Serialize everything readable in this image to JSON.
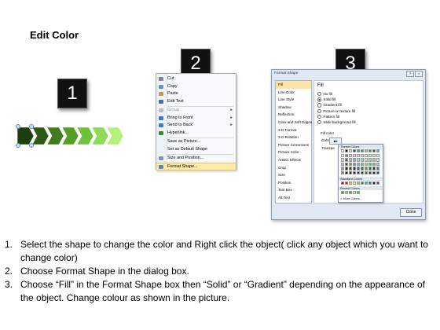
{
  "title": "Edit Color",
  "step_numbers": [
    "1",
    "2",
    "3"
  ],
  "context_menu": {
    "items": [
      {
        "label": "Cut",
        "icon": "scissors-icon",
        "icon_color": "#7a8aa0",
        "disabled": false,
        "submenu": false
      },
      {
        "label": "Copy",
        "icon": "copy-icon",
        "icon_color": "#6f8fc0",
        "disabled": false,
        "submenu": false
      },
      {
        "label": "Paste",
        "icon": "paste-icon",
        "icon_color": "#c59a45",
        "disabled": false,
        "submenu": false
      },
      {
        "label": "Edit Text",
        "icon": "edit-text-icon",
        "icon_color": "#4a6ea8",
        "disabled": false,
        "submenu": false
      },
      {
        "label": "Group",
        "icon": "group-icon",
        "icon_color": "#b8bec7",
        "disabled": true,
        "submenu": true
      },
      {
        "label": "Bring to Front",
        "icon": "bring-to-front-icon",
        "icon_color": "#3c78c8",
        "disabled": false,
        "submenu": true
      },
      {
        "label": "Send to Back",
        "icon": "send-to-back-icon",
        "icon_color": "#3c78c8",
        "disabled": false,
        "submenu": true
      },
      {
        "label": "Hyperlink...",
        "icon": "hyperlink-icon",
        "icon_color": "#3a8a3a",
        "disabled": false,
        "submenu": false
      },
      {
        "label": "Save as Picture...",
        "icon": "",
        "icon_color": "",
        "disabled": false,
        "submenu": false
      },
      {
        "label": "Set as Default Shape",
        "icon": "",
        "icon_color": "",
        "disabled": false,
        "submenu": false
      },
      {
        "label": "Size and Position...",
        "icon": "size-position-icon",
        "icon_color": "#7f95b5",
        "disabled": false,
        "submenu": false
      },
      {
        "label": "Format Shape...",
        "icon": "format-shape-icon",
        "icon_color": "#5d84c4",
        "disabled": false,
        "submenu": false,
        "highlighted": true
      }
    ]
  },
  "dialog": {
    "title": "Format Shape",
    "window_buttons": [
      "?",
      "×"
    ],
    "categories": [
      "Fill",
      "Line Color",
      "Line Style",
      "Shadow",
      "Reflection",
      "Glow and Soft Edges",
      "3-D Format",
      "3-D Rotation",
      "Picture Corrections",
      "Picture Color",
      "Artistic Effects",
      "Crop",
      "Size",
      "Position",
      "Text Box",
      "Alt Text"
    ],
    "selected_category": "Fill",
    "fill_heading": "Fill",
    "fill_options": [
      {
        "label": "No fill",
        "selected": false
      },
      {
        "label": "Solid fill",
        "selected": true
      },
      {
        "label": "Gradient fill",
        "selected": false
      },
      {
        "label": "Picture or texture fill",
        "selected": false
      },
      {
        "label": "Pattern fill",
        "selected": false
      },
      {
        "label": "Slide background fill",
        "selected": false
      }
    ],
    "fill_color_label": "Fill color",
    "color_label": "Color:",
    "transparency_label": "Transpa",
    "color_popup": {
      "theme_label": "Theme Colors",
      "standard_label": "Standard Colors",
      "recent_label": "Recent Colors",
      "more_label": "More Colors...",
      "theme_top_row": [
        "#ffffff",
        "#000000",
        "#eeece1",
        "#1f497d",
        "#4f81bd",
        "#00b050",
        "#92d050",
        "#00b050",
        "#375623",
        "#4bacc6"
      ],
      "theme_shades": [
        [
          "#f2f2f2",
          "#7f7f7f",
          "#ddd9c3",
          "#c6d9f0",
          "#dbe5f1",
          "#c6efce",
          "#ebf1de",
          "#c6efce",
          "#d8e4bc",
          "#dbeef3"
        ],
        [
          "#d8d8d8",
          "#595959",
          "#c4bd97",
          "#8db3e2",
          "#b8cce4",
          "#8ee0a0",
          "#d7e4bc",
          "#8ee0a0",
          "#b1c996",
          "#b7dde8"
        ],
        [
          "#bfbfbf",
          "#3f3f3f",
          "#938953",
          "#548dd4",
          "#95b3d7",
          "#55d070",
          "#c3d69b",
          "#55d070",
          "#8aad6e",
          "#92cddc"
        ],
        [
          "#a5a5a5",
          "#262626",
          "#494429",
          "#17365d",
          "#366092",
          "#008a3a",
          "#76923c",
          "#008a3a",
          "#294119",
          "#31859b"
        ],
        [
          "#7f7f7f",
          "#0c0c0c",
          "#1d1b10",
          "#0f243e",
          "#244061",
          "#005c26",
          "#4f6128",
          "#005c26",
          "#1b2b10",
          "#205867"
        ]
      ],
      "standard_colors": [
        "#c00000",
        "#ff0000",
        "#ffc000",
        "#ffff00",
        "#92d050",
        "#00b050",
        "#00b0f0",
        "#0070c0",
        "#002060",
        "#7030a0"
      ],
      "recent_colors": [
        "#00b050",
        "#92d050",
        "#5aa02c",
        "#c3e89a",
        "#33cc66"
      ]
    },
    "close_label": "Close"
  },
  "instructions": [
    {
      "num": "1.",
      "text": "Select the shape to change the color and Right click the object( click any object which you want to change color)"
    },
    {
      "num": "2.",
      "text": "Choose Format Shape in the dialog box."
    },
    {
      "num": "3.",
      "text": "Choose “Fill” in the Format Shape box then “Solid” or “Gradient” depending on the appearance of the object. Change colour as shown in the picture."
    }
  ],
  "colors": {
    "chevrons": [
      "#1e3d0c",
      "#2d5a13",
      "#3f7c1c",
      "#52a024",
      "#6cc33a",
      "#8edc55",
      "#b4f07a"
    ]
  }
}
